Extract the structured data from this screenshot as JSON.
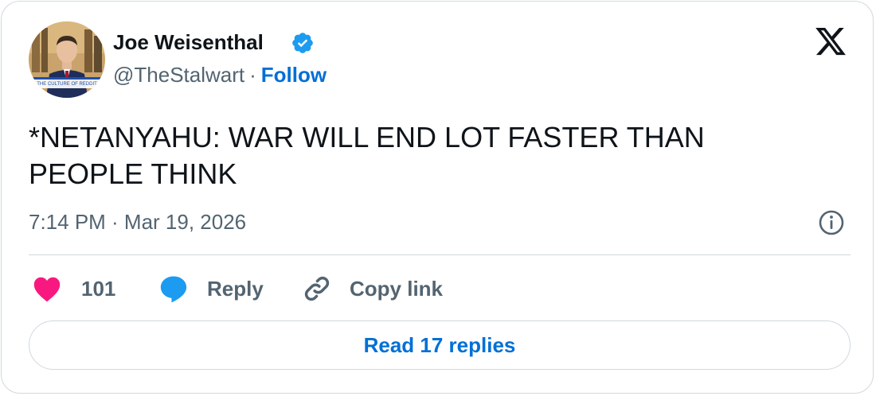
{
  "author": {
    "name": "Joe Weisenthal",
    "handle": "@TheStalwart",
    "separator": "·",
    "follow_label": "Follow",
    "verified": true,
    "avatar_caption": "THE CULTURE OF REDDIT"
  },
  "tweet": {
    "text": "*NETANYAHU: WAR WILL END LOT FASTER THAN PEOPLE THINK",
    "timestamp": "7:14 PM · Mar 19, 2026"
  },
  "actions": {
    "like_count": "101",
    "reply_label": "Reply",
    "copy_link_label": "Copy link"
  },
  "read_replies_label": "Read 17 replies",
  "icons": {
    "verified": "verified-badge-icon",
    "brand": "x-logo-icon",
    "info": "info-icon",
    "like": "heart-icon",
    "reply": "speech-bubble-icon",
    "copy": "link-icon"
  },
  "colors": {
    "accent": "#006fd6",
    "verified": "#1d9bf0",
    "like": "#f91880",
    "reply": "#1d9bf0",
    "text": "#0f1419",
    "muted": "#536471",
    "border": "#cfd9de"
  }
}
